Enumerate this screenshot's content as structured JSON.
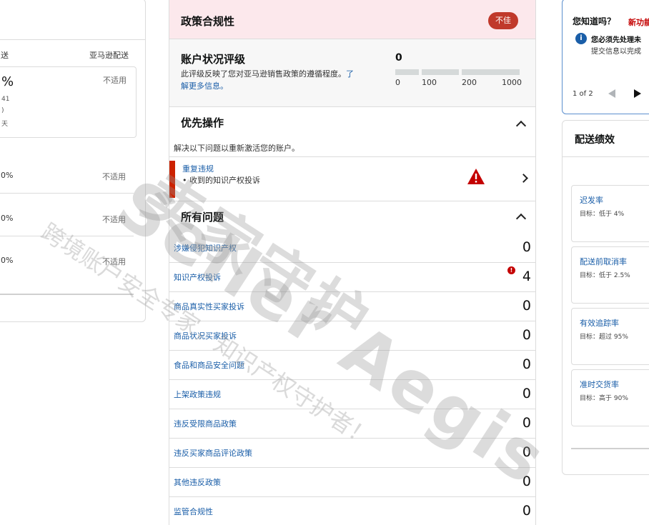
{
  "left_panel": {
    "col_partial": "送",
    "col_amazon": "亚马逊配送",
    "card_value_partial": "%",
    "card_line1_partial": "41",
    "card_line2_partial": ")",
    "card_line3_partial": "天",
    "card_na": "不适用",
    "rows": [
      {
        "partial": "0%",
        "na": "不适用"
      },
      {
        "partial": "0%",
        "na": "不适用"
      },
      {
        "partial": "0%",
        "na": "不适用"
      }
    ]
  },
  "policy": {
    "title": "政策合规性",
    "badge": "不佳",
    "rating_title": "账户状况评级",
    "rating_desc_1": "此评级反映了您对亚马逊销售政策的遵循程度。",
    "rating_link_1": "了",
    "rating_link_2": "解更多信息。",
    "rating_value": "0",
    "scale": [
      "0",
      "100",
      "200",
      "1000"
    ],
    "priority_title": "优先操作",
    "priority_desc": "解决以下问题以重新激活您的账户。",
    "alert_title": "重复违规",
    "alert_item": "• 收到的知识产权投诉",
    "all_issues_title": "所有问题",
    "issues": [
      {
        "label": "涉嫌侵犯知识产权",
        "count": "0"
      },
      {
        "label": "知识产权投诉",
        "count": "4"
      },
      {
        "label": "商品真实性买家投诉",
        "count": "0"
      },
      {
        "label": "商品状况买家投诉",
        "count": "0"
      },
      {
        "label": "食品和商品安全问题",
        "count": "0"
      },
      {
        "label": "上架政策违规",
        "count": "0"
      },
      {
        "label": "违反受限商品政策",
        "count": "0"
      },
      {
        "label": "违反买家商品评论政策",
        "count": "0"
      },
      {
        "label": "其他违反政策",
        "count": "0"
      },
      {
        "label": "监管合规性",
        "count": "0"
      }
    ],
    "err_mark": "!"
  },
  "dyk": {
    "title": "您知道吗？",
    "new_tag": "新功能",
    "line1": "您必须先处理未",
    "line2": "提交信息以完成",
    "pager": "1 of 2",
    "info_mark": "i"
  },
  "performance": {
    "title": "配送绩效",
    "metrics": [
      {
        "name": "迟发率",
        "target": "目标：低于 4%"
      },
      {
        "name": "配送前取消率",
        "target": "目标：低于 2.5%"
      },
      {
        "name": "有效追踪率",
        "target": "目标：超过 95%"
      },
      {
        "name": "准时交货率",
        "target": "目标：高于 90%"
      }
    ]
  },
  "watermark": {
    "brand": "Seller Aegis",
    "cn": "卖家守护",
    "slogan": "跨境账户安全专家，知识产权守护者！"
  },
  "colors": {
    "policy_bg": "#fce8ec",
    "badge": "#c0392b",
    "link": "#1a5ea8",
    "alert_bar": "#cc2200",
    "warning_triangle": "#c40000"
  }
}
